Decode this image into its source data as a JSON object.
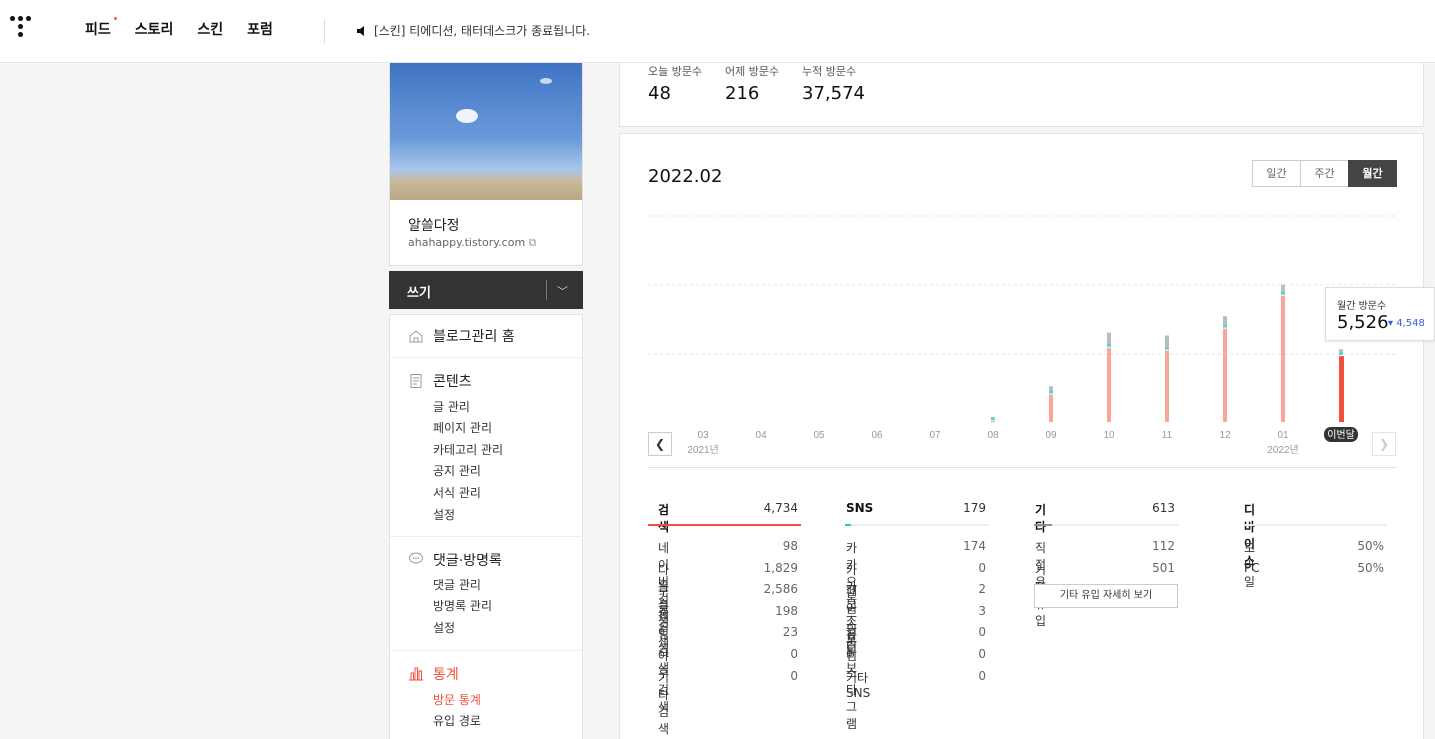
{
  "nav": {
    "items": [
      "피드",
      "스토리",
      "스킨",
      "포럼"
    ],
    "notice": "[스킨] 티에디션, 태터데스크가 종료됩니다."
  },
  "blog": {
    "name": "알쓸다정",
    "url": "ahahappy.tistory.com"
  },
  "write": {
    "label": "쓰기"
  },
  "menu": {
    "home": "블로그관리 홈",
    "content": {
      "title": "콘텐츠",
      "items": [
        "글 관리",
        "페이지 관리",
        "카테고리 관리",
        "공지 관리",
        "서식 관리",
        "설정"
      ]
    },
    "comments": {
      "title": "댓글·방명록",
      "items": [
        "댓글 관리",
        "방명록 관리",
        "설정"
      ]
    },
    "stats": {
      "title": "통계",
      "items": [
        "방문 통계",
        "유입 경로"
      ]
    }
  },
  "visits": {
    "today_label": "오늘 방문수",
    "today": "48",
    "yesterday_label": "어제 방문수",
    "yesterday": "216",
    "total_label": "누적 방문수",
    "total": "37,574"
  },
  "period": {
    "title": "2022.02",
    "tabs": [
      "일간",
      "주간",
      "월간"
    ],
    "selected": "월간"
  },
  "tooltip": {
    "label": "월간 방문수",
    "value": "5,526",
    "delta": "▾ 4,548"
  },
  "chart_data": {
    "type": "bar",
    "categories": [
      "03",
      "04",
      "05",
      "06",
      "07",
      "08",
      "09",
      "10",
      "11",
      "12",
      "01",
      "이번달"
    ],
    "year_labels": {
      "03": "2021년",
      "01": "2022년"
    },
    "series": [
      {
        "values": [
          0,
          0,
          0,
          0,
          0,
          30,
          1000,
          2700,
          2600,
          3400,
          4600,
          2400
        ]
      }
    ],
    "totals": [
      0,
      0,
      0,
      0,
      0,
      30,
      1300,
      3250,
      3150,
      3850,
      5000,
      2650
    ],
    "highlight_index": 11,
    "ylim": [
      0,
      7500
    ],
    "grid": true,
    "colors": {
      "bar": "#f7a89b",
      "current": "#f0503c",
      "teal": "#62cfcf",
      "gray": "#b9bcc2"
    }
  },
  "sources": {
    "search": {
      "title": "검색",
      "total": "4,734",
      "color": "#f0503c",
      "rows": [
        [
          "네이버 검색",
          "98"
        ],
        [
          "다음 검색",
          "1,829"
        ],
        [
          "구글 검색",
          "2,586"
        ],
        [
          "줌 검색",
          "198"
        ],
        [
          "빙 검색",
          "23"
        ],
        [
          "야후 검색",
          "0"
        ],
        [
          "기타 검색",
          "0"
        ]
      ]
    },
    "sns": {
      "title": "SNS",
      "total": "179",
      "color": "#30c5c5",
      "rows": [
        [
          "카카오톡",
          "174"
        ],
        [
          "카카오스토리",
          "0"
        ],
        [
          "페이스북",
          "2"
        ],
        [
          "트위터",
          "3"
        ],
        [
          "유튜브",
          "0"
        ],
        [
          "인스타그램",
          "0"
        ],
        [
          "기타 SNS",
          "0"
        ]
      ]
    },
    "etc": {
      "title": "기타",
      "total": "613",
      "color": "#8a8f9c",
      "rows": [
        [
          "직접 유입",
          "112"
        ],
        [
          "기타 유입",
          "501"
        ]
      ],
      "button": "기타 유입 자세히 보기"
    },
    "device": {
      "title": "디바이스",
      "rows": [
        [
          "모바일",
          "50%"
        ],
        [
          "PC",
          "50%"
        ]
      ]
    }
  }
}
